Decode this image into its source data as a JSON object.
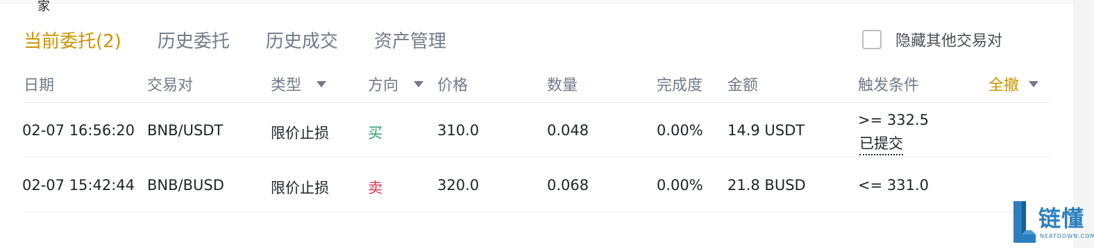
{
  "top_fragment": "家",
  "tabs": [
    {
      "label": "当前委托(2)",
      "active": true
    },
    {
      "label": "历史委托",
      "active": false
    },
    {
      "label": "历史成交",
      "active": false
    },
    {
      "label": "资产管理",
      "active": false
    }
  ],
  "hide_others": {
    "label": "隐藏其他交易对",
    "checked": false
  },
  "columns": {
    "date": "日期",
    "pair": "交易对",
    "type": "类型",
    "side": "方向",
    "price": "价格",
    "amount": "数量",
    "filled": "完成度",
    "total": "金额",
    "trigger": "触发条件",
    "cancel_all": "全撤"
  },
  "orders": [
    {
      "date": "02-07 16:56:20",
      "pair": "BNB/USDT",
      "type": "限价止损",
      "side": "买",
      "price": "310.0",
      "amount": "0.048",
      "filled": "0.00%",
      "total": "14.9 USDT",
      "trigger": ">= 332.5",
      "trigger_status": "已提交"
    },
    {
      "date": "02-07 15:42:44",
      "pair": "BNB/BUSD",
      "type": "限价止损",
      "side": "卖",
      "price": "320.0",
      "amount": "0.068",
      "filled": "0.00%",
      "total": "21.8 BUSD",
      "trigger": "<= 331.0"
    }
  ],
  "colors": {
    "accent": "#c99400",
    "buy": "#2ea06a",
    "sell": "#d9304e",
    "muted": "#707a8a"
  },
  "watermark": {
    "text": "链懂",
    "sub": "NEATDOWN.COM"
  }
}
